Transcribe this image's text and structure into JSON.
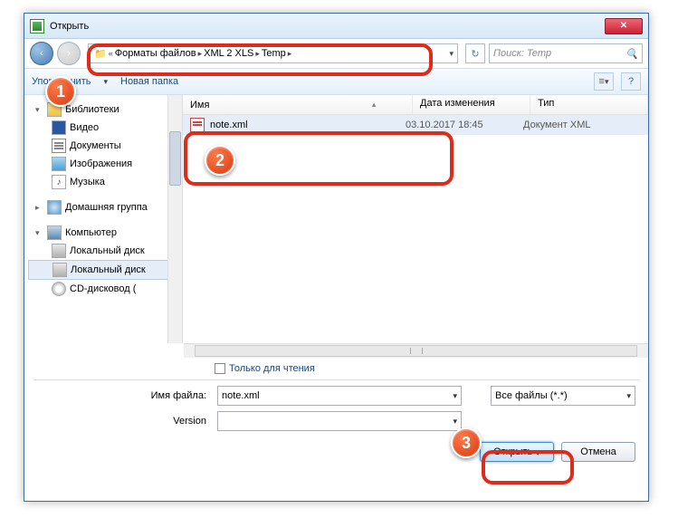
{
  "window": {
    "title": "Открыть"
  },
  "nav": {
    "back": "‹",
    "fwd": "›",
    "prefix": "«",
    "crumbs": [
      "Форматы файлов",
      "XML 2 XLS",
      "Temp"
    ],
    "refresh": "↻",
    "search_placeholder": "Поиск: Temp"
  },
  "toolbar": {
    "organize": "Упорядочить",
    "newfolder": "Новая папка",
    "view_icon": "≡",
    "help_icon": "?"
  },
  "tree": {
    "libraries": "Библиотеки",
    "video": "Видео",
    "documents": "Документы",
    "images": "Изображения",
    "music": "Музыка",
    "homegroup": "Домашняя группа",
    "computer": "Компьютер",
    "drive1": "Локальный диск",
    "drive2": "Локальный диск",
    "cd": "CD-дисковод ("
  },
  "columns": {
    "name": "Имя",
    "date": "Дата изменения",
    "type": "Тип",
    "sort": "▲"
  },
  "files": [
    {
      "name": "note.xml",
      "date": "03.10.2017 18:45",
      "type": "Документ XML"
    }
  ],
  "readonly": {
    "label": "Только для чтения"
  },
  "form": {
    "filename_label": "Имя файла:",
    "filename_value": "note.xml",
    "filter_value": "Все файлы (*.*)",
    "version_label": "Version",
    "version_value": "",
    "open": "Открыть",
    "open_dd": "▾",
    "cancel": "Отмена"
  },
  "annotations": {
    "c1": "1",
    "c2": "2",
    "c3": "3"
  },
  "colors": {
    "accent": "#dd2b1c",
    "link": "#1a4a7a"
  }
}
